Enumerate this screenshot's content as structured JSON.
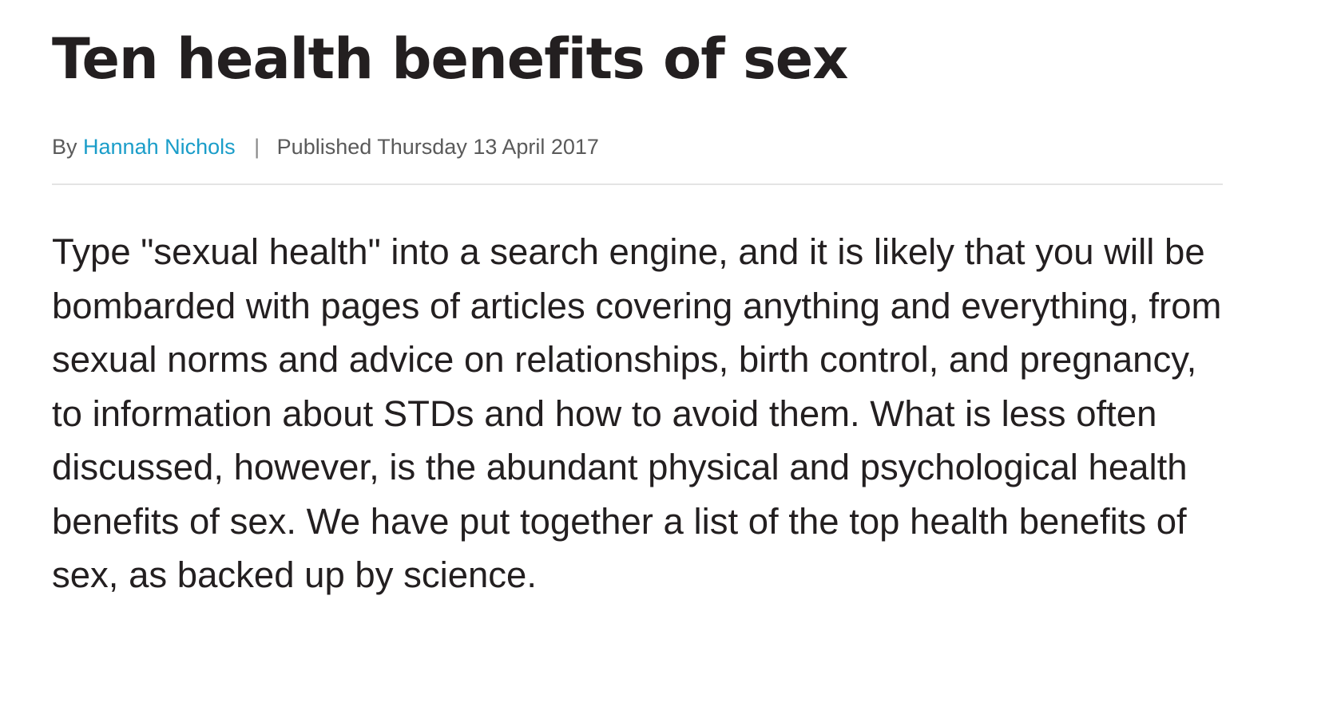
{
  "article": {
    "title": "Ten health benefits of sex",
    "byline": {
      "by_label": "By",
      "author": "Hannah Nichols",
      "separator": "|",
      "published": "Published Thursday 13 April 2017"
    },
    "intro": "Type \"sexual health\" into a search engine, and it is likely that you will be bombarded with pages of articles covering anything and everything, from sexual norms and advice on relationships, birth control, and pregnancy, to information about STDs and how to avoid them. What is less often discussed, however, is the abundant physical and psychological health benefits of sex. We have put together a list of the top health benefits of sex, as backed up by science."
  },
  "colors": {
    "text": "#231f20",
    "meta": "#5a5a5a",
    "author_link": "#1a9dc9",
    "divider": "#e4e4e4"
  }
}
